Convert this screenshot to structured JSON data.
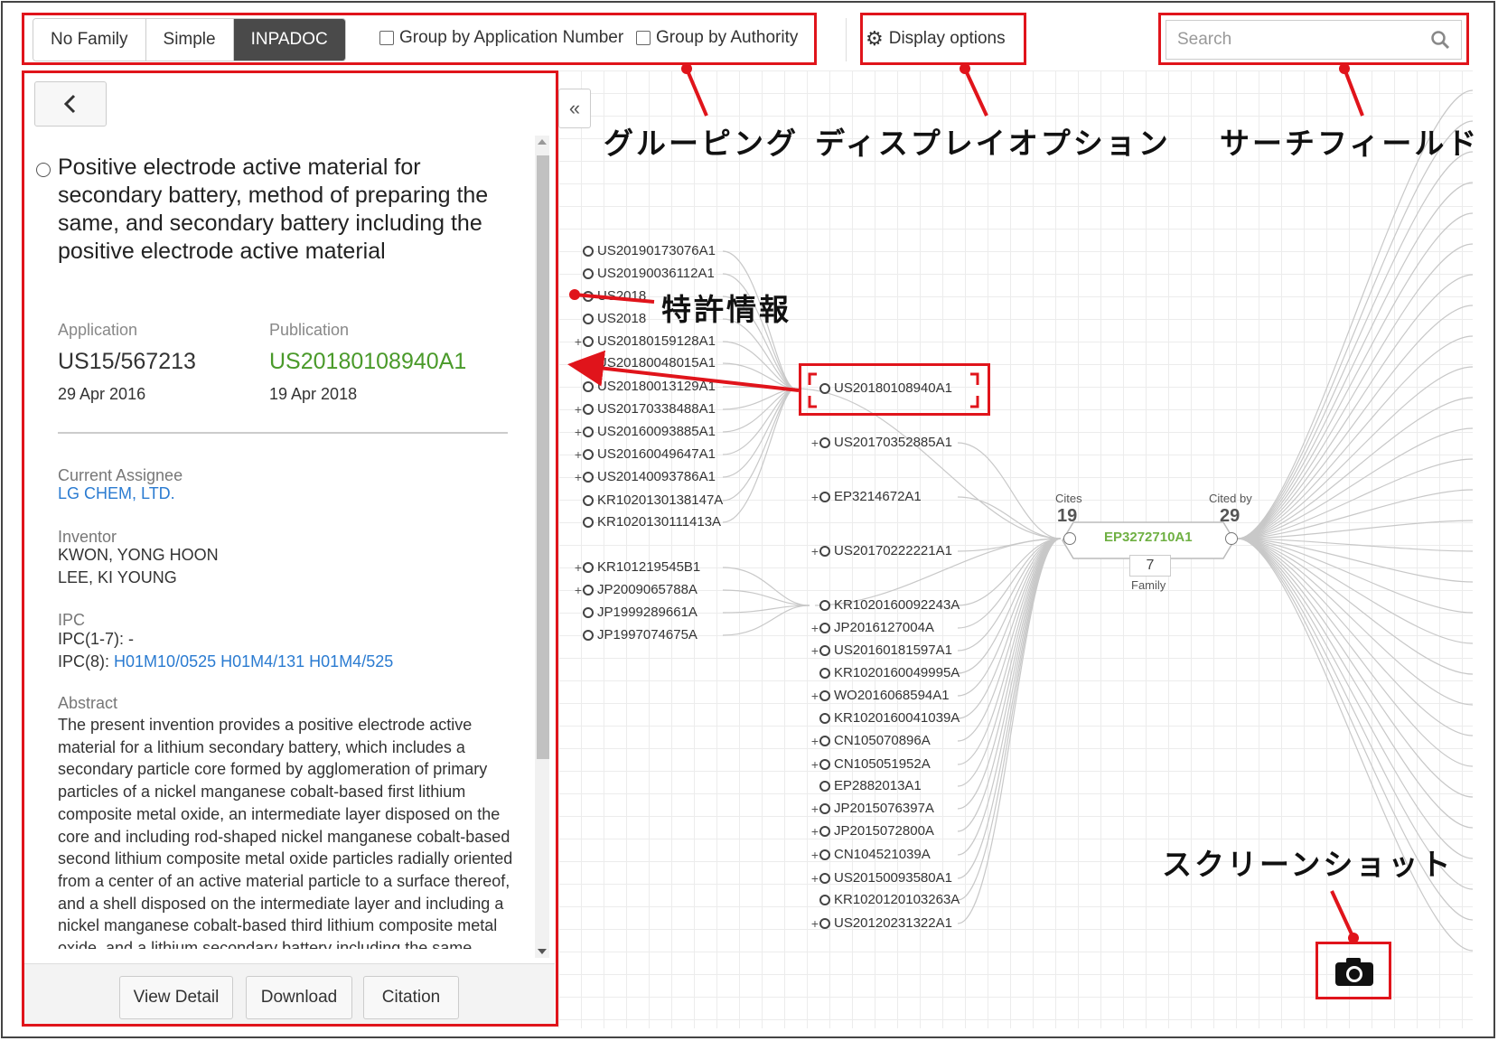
{
  "toolbar": {
    "family_tabs": [
      "No Family",
      "Simple",
      "INPADOC"
    ],
    "group_by_application": "Group by Application Number",
    "group_by_authority": "Group by Authority",
    "display_options": "Display options",
    "search_placeholder": "Search"
  },
  "panel": {
    "title": "Positive electrode active material for secondary battery, method of preparing the same, and secondary battery including the positive electrode active material",
    "application_label": "Application",
    "application_number": "US15/567213",
    "application_date": "29 Apr 2016",
    "publication_label": "Publication",
    "publication_number": "US20180108940A1",
    "publication_date": "19 Apr 2018",
    "assignee_label": "Current Assignee",
    "assignee": "LG CHEM, LTD.",
    "inventor_label": "Inventor",
    "inventors": [
      "KWON, YONG HOON",
      "LEE, KI YOUNG"
    ],
    "ipc_label": "IPC",
    "ipc_1_7": "IPC(1-7): -",
    "ipc_8_label": "IPC(8):",
    "ipc_8_codes": "H01M10/0525 H01M4/131 H01M4/525",
    "abstract_label": "Abstract",
    "abstract": "The present invention provides a positive electrode active material for a lithium secondary battery, which includes a secondary particle core formed by agglomeration of primary particles of a nickel manganese cobalt-based first lithium composite metal oxide, an intermediate layer disposed on the core and including rod-shaped nickel manganese cobalt-based second lithium composite metal oxide particles radially oriented from a center of an active material particle to a surface thereof, and a shell disposed on the intermediate layer and including a nickel manganese cobalt-based third lithium composite metal oxide, and a lithium secondary battery including the same.",
    "buttons": {
      "view_detail": "View Detail",
      "download": "Download",
      "citation": "Citation"
    }
  },
  "graph": {
    "center": "EP3272710A1",
    "cites_label": "Cites",
    "cites_count": "19",
    "cited_by_label": "Cited by",
    "cited_by_count": "29",
    "family_count": "7",
    "family_label": "Family",
    "left_col": [
      {
        "id": "US20190173076A1",
        "plus": ""
      },
      {
        "id": "US20190036112A1",
        "plus": ""
      },
      {
        "id": "US2018",
        "plus": ""
      },
      {
        "id": "US2018",
        "plus": ""
      },
      {
        "id": "US20180159128A1",
        "plus": "+"
      },
      {
        "id": "US20180048015A1",
        "plus": ""
      },
      {
        "id": "US20180013129A1",
        "plus": ""
      },
      {
        "id": "US20170338488A1",
        "plus": "+"
      },
      {
        "id": "US20160093885A1",
        "plus": "+"
      },
      {
        "id": "US20160049647A1",
        "plus": "+"
      },
      {
        "id": "US20140093786A1",
        "plus": "+"
      },
      {
        "id": "KR1020130138147A",
        "plus": ""
      },
      {
        "id": "KR1020130111413A",
        "plus": ""
      },
      {
        "id": "KR101219545B1",
        "plus": "+"
      },
      {
        "id": "JP2009065788A",
        "plus": "+"
      },
      {
        "id": "JP1999289661A",
        "plus": ""
      },
      {
        "id": "JP1997074675A",
        "plus": ""
      }
    ],
    "mid_col": [
      {
        "id": "US20180108940A1",
        "plus": ""
      },
      {
        "id": "US20170352885A1",
        "plus": "+"
      },
      {
        "id": "EP3214672A1",
        "plus": "+"
      },
      {
        "id": "US20170222221A1",
        "plus": "+"
      },
      {
        "id": "KR1020160092243A",
        "plus": ""
      },
      {
        "id": "JP2016127004A",
        "plus": "+"
      },
      {
        "id": "US20160181597A1",
        "plus": "+"
      },
      {
        "id": "KR1020160049995A",
        "plus": ""
      },
      {
        "id": "WO2016068594A1",
        "plus": "+"
      },
      {
        "id": "KR1020160041039A",
        "plus": ""
      },
      {
        "id": "CN105070896A",
        "plus": "+"
      },
      {
        "id": "CN105051952A",
        "plus": "+"
      },
      {
        "id": "EP2882013A1",
        "plus": ""
      },
      {
        "id": "JP2015076397A",
        "plus": "+"
      },
      {
        "id": "JP2015072800A",
        "plus": "+"
      },
      {
        "id": "CN104521039A",
        "plus": "+"
      },
      {
        "id": "US20150093580A1",
        "plus": "+"
      },
      {
        "id": "KR1020120103263A",
        "plus": ""
      },
      {
        "id": "US20120231322A1",
        "plus": "+"
      }
    ]
  },
  "annotations": {
    "grouping": "グルーピング",
    "display_option": "ディスプレイオプション",
    "search_field": "サーチフィールド",
    "patent_info": "特許情報",
    "screenshot": "スクリーンショット"
  },
  "colors": {
    "annotation_red": "#e0141b",
    "link_blue": "#2a7bd1",
    "pub_green": "#4a9a2a",
    "active_tab": "#4a4a4a"
  }
}
